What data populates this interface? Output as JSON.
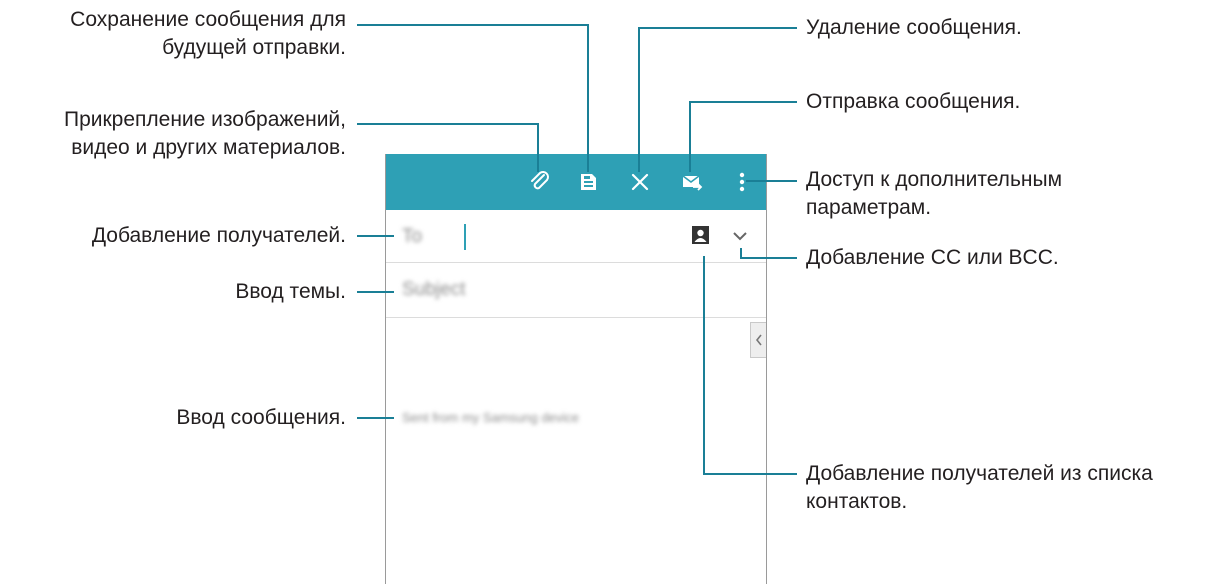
{
  "callouts": {
    "save_draft": [
      "Сохранение сообщения для",
      "будущей отправки."
    ],
    "attach": [
      "Прикрепление изображений,",
      "видео и других материалов."
    ],
    "add_recipients": "Добавление получателей.",
    "enter_subject": "Ввод темы.",
    "enter_message": "Ввод сообщения.",
    "delete": "Удаление сообщения.",
    "send": "Отправка сообщения.",
    "more_options": [
      "Доступ к дополнительным",
      "параметрам."
    ],
    "add_cc_bcc": "Добавление CC или BCC.",
    "add_from_contacts": [
      "Добавление получателей из списка",
      "контактов."
    ]
  },
  "compose": {
    "to_placeholder": "To",
    "subject_placeholder": "Subject",
    "signature": "Sent from my Samsung device"
  },
  "colors": {
    "actionbar": "#2ea0b5",
    "callout_line": "#1a7f96"
  },
  "icons": [
    "paperclip-icon",
    "save-icon",
    "close-icon",
    "send-mail-icon",
    "more-vert-icon",
    "contact-icon",
    "chevron-down-icon",
    "chevron-left-icon"
  ]
}
